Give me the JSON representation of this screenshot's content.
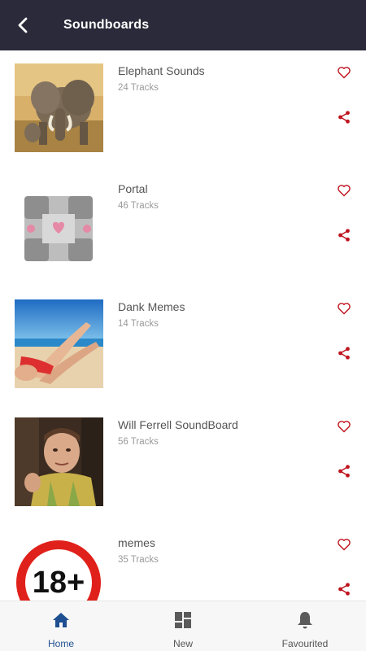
{
  "appbar": {
    "title": "Soundboards"
  },
  "colors": {
    "appbar_bg": "#2a2a3a",
    "accent_red": "#c0141e",
    "active_nav": "#1e4f91",
    "inactive_nav": "#555555"
  },
  "soundboards": [
    {
      "title": "Elephant Sounds",
      "tracks": "24 Tracks",
      "thumbnail": "elephant-image"
    },
    {
      "title": "Portal",
      "tracks": "46 Tracks",
      "thumbnail": "companion-cube-image"
    },
    {
      "title": "Dank Memes",
      "tracks": "14 Tracks",
      "thumbnail": "beach-image"
    },
    {
      "title": "Will Ferrell SoundBoard",
      "tracks": "56 Tracks",
      "thumbnail": "will-ferrell-image"
    },
    {
      "title": "memes",
      "tracks": "35 Tracks",
      "thumbnail": "18-plus-sign-image"
    }
  ],
  "bottom_nav": [
    {
      "label": "Home",
      "icon": "home-icon",
      "active": true
    },
    {
      "label": "New",
      "icon": "dashboard-icon",
      "active": false
    },
    {
      "label": "Favourited",
      "icon": "bell-icon",
      "active": false
    }
  ]
}
